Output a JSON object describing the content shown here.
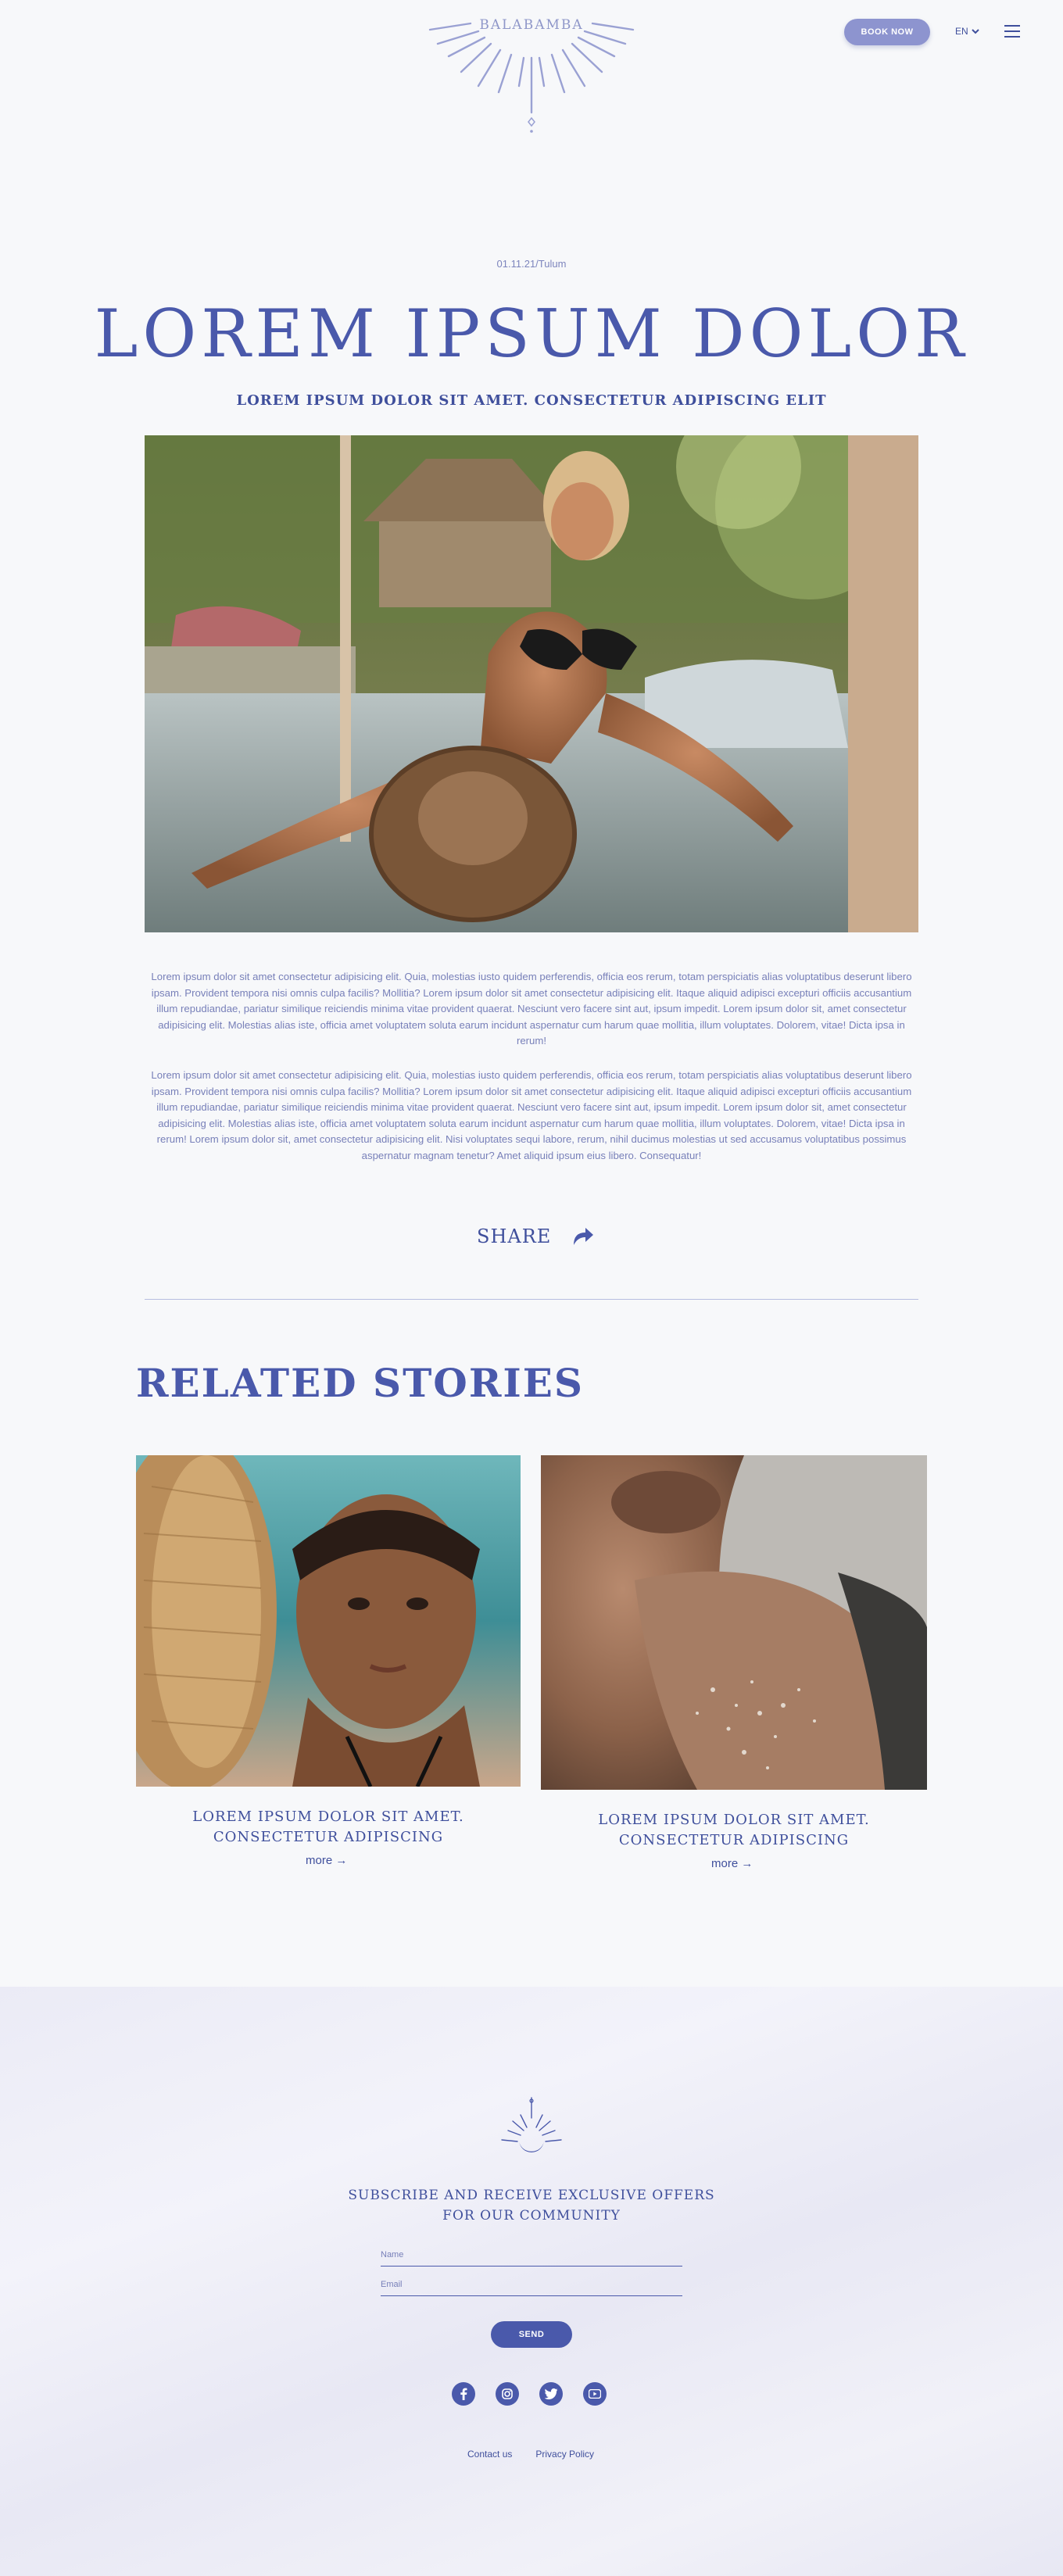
{
  "header": {
    "logo_text": "BALABAMBA",
    "book_button": "BOOK NOW",
    "language": "EN"
  },
  "article": {
    "meta": "01.11.21/Tulum",
    "title": "LOREM IPSUM DOLOR",
    "subtitle": "LOREM IPSUM DOLOR SIT AMET. CONSECTETUR ADIPISCING ELIT",
    "paragraph_1": "Lorem ipsum dolor sit amet consectetur adipisicing elit. Quia, molestias iusto quidem perferendis, officia eos rerum, totam perspiciatis alias voluptatibus deserunt libero ipsam. Provident tempora nisi omnis culpa facilis? Mollitia? Lorem ipsum dolor sit amet consectetur adipisicing elit. Itaque aliquid adipisci excepturi officiis accusantium illum repudiandae, pariatur similique reiciendis minima vitae provident quaerat. Nesciunt vero facere sint aut, ipsum impedit. Lorem ipsum dolor sit, amet consectetur adipisicing elit. Molestias alias iste, officia amet voluptatem soluta earum incidunt aspernatur cum harum quae mollitia, illum voluptates. Dolorem, vitae! Dicta ipsa in rerum!",
    "paragraph_2": "Lorem ipsum dolor sit amet consectetur adipisicing elit. Quia, molestias iusto quidem perferendis, officia eos rerum, totam perspiciatis alias voluptatibus deserunt libero ipsam. Provident tempora nisi omnis culpa facilis? Mollitia? Lorem ipsum dolor sit amet consectetur adipisicing elit. Itaque aliquid adipisci excepturi officiis accusantium illum repudiandae, pariatur similique reiciendis minima vitae provident quaerat. Nesciunt vero facere sint aut, ipsum impedit. Lorem ipsum dolor sit, amet consectetur adipisicing elit. Molestias alias iste, officia amet voluptatem soluta earum incidunt aspernatur cum harum quae mollitia, illum voluptates. Dolorem, vitae! Dicta ipsa in rerum! Lorem ipsum dolor sit, amet consectetur adipisicing elit. Nisi voluptates sequi labore, rerum, nihil ducimus molestias ut sed accusamus voluptatibus possimus aspernatur magnam tenetur? Amet aliquid ipsum eius libero. Consequatur!",
    "share_label": "SHARE"
  },
  "related": {
    "title": "RELATED STORIES",
    "cards": [
      {
        "title": "LOREM IPSUM DOLOR SIT AMET. CONSECTETUR ADIPISCING",
        "more": "more →"
      },
      {
        "title": "LOREM IPSUM DOLOR SIT AMET. CONSECTETUR ADIPISCING",
        "more": "more →"
      }
    ]
  },
  "footer": {
    "subscribe_text": "SUBSCRIBE AND RECEIVE EXCLUSIVE OFFERS FOR OUR COMMUNITY",
    "name_placeholder": "Name",
    "email_placeholder": "Email",
    "send_button": "SEND",
    "socials": [
      "facebook-icon",
      "instagram-icon",
      "twitter-icon",
      "youtube-icon"
    ],
    "links": [
      "Contact us",
      "Privacy Policy"
    ]
  },
  "colors": {
    "brand": "#4a59ab",
    "accent_button": "#8d94cf",
    "background": "#f7f8fa"
  }
}
